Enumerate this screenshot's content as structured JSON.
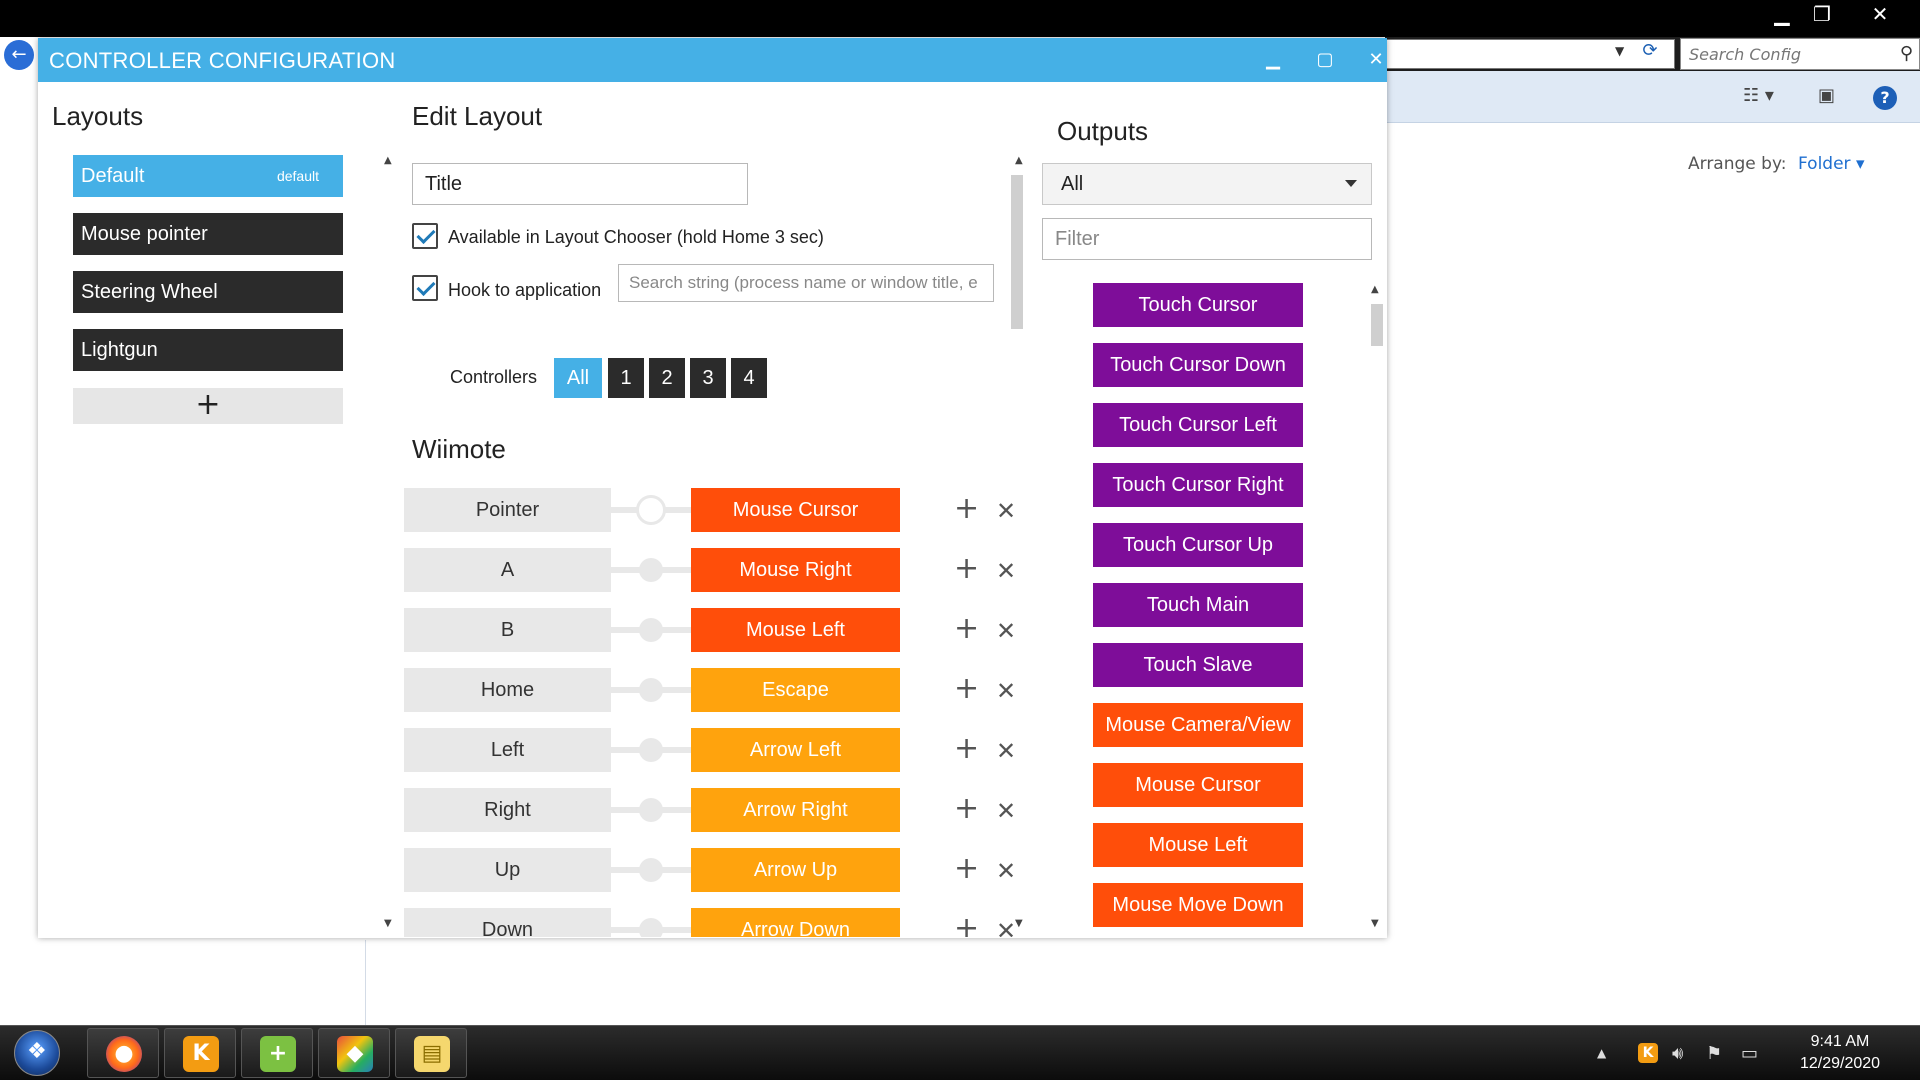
{
  "window": {
    "title": "CONTROLLER CONFIGURATION",
    "minimize_icon": "minimize-icon",
    "maximize_icon": "maximize-icon",
    "close_icon": "close-icon"
  },
  "background_window": {
    "search_placeholder": "Search Config",
    "arrange_label": "Arrange by:",
    "arrange_value": "Folder"
  },
  "layouts": {
    "heading": "Layouts",
    "items": [
      {
        "label": "Default",
        "tag": "default",
        "active": true
      },
      {
        "label": "Mouse pointer"
      },
      {
        "label": "Steering Wheel"
      },
      {
        "label": "Lightgun"
      }
    ],
    "add_label": "+"
  },
  "edit_layout": {
    "heading": "Edit Layout",
    "title_value": "Title",
    "available_label": "Available in Layout Chooser (hold Home 3 sec)",
    "available_checked": true,
    "hook_label": "Hook to application",
    "hook_checked": true,
    "hook_placeholder": "Search string (process name or window title, e",
    "controllers_label": "Controllers",
    "controllers": [
      "All",
      "1",
      "2",
      "3",
      "4"
    ],
    "controllers_selected": "All"
  },
  "wiimote": {
    "heading": "Wiimote",
    "mappings": [
      {
        "input": "Pointer",
        "output": "Mouse Cursor",
        "color": "#ff4e0a"
      },
      {
        "input": "A",
        "output": "Mouse Right",
        "color": "#ff4e0a"
      },
      {
        "input": "B",
        "output": "Mouse Left",
        "color": "#ff4e0a"
      },
      {
        "input": "Home",
        "output": "Escape",
        "color": "#ffa30d"
      },
      {
        "input": "Left",
        "output": "Arrow Left",
        "color": "#ffa30d"
      },
      {
        "input": "Right",
        "output": "Arrow Right",
        "color": "#ffa30d"
      },
      {
        "input": "Up",
        "output": "Arrow Up",
        "color": "#ffa30d"
      },
      {
        "input": "Down",
        "output": "Arrow Down",
        "color": "#ffa30d"
      }
    ]
  },
  "outputs": {
    "heading": "Outputs",
    "filter_value": "All",
    "filter_placeholder": "Filter",
    "items": [
      {
        "label": "Touch Cursor",
        "color": "#7e0d99"
      },
      {
        "label": "Touch Cursor Down",
        "color": "#7e0d99"
      },
      {
        "label": "Touch Cursor Left",
        "color": "#7e0d99"
      },
      {
        "label": "Touch Cursor Right",
        "color": "#7e0d99"
      },
      {
        "label": "Touch Cursor Up",
        "color": "#7e0d99"
      },
      {
        "label": "Touch Main",
        "color": "#7e0d99"
      },
      {
        "label": "Touch Slave",
        "color": "#7e0d99"
      },
      {
        "label": "Mouse Camera/View",
        "color": "#ff4e0a"
      },
      {
        "label": "Mouse Cursor",
        "color": "#ff4e0a"
      },
      {
        "label": "Mouse Left",
        "color": "#ff4e0a"
      },
      {
        "label": "Mouse Move Down",
        "color": "#ff4e0a"
      }
    ]
  },
  "taskbar": {
    "apps": [
      "firefox-icon",
      "kodi-gamepad-icon",
      "green-plus-app-icon",
      "rubiks-cube-icon",
      "file-explorer-icon"
    ],
    "time": "9:41 AM",
    "date": "12/29/2020"
  }
}
